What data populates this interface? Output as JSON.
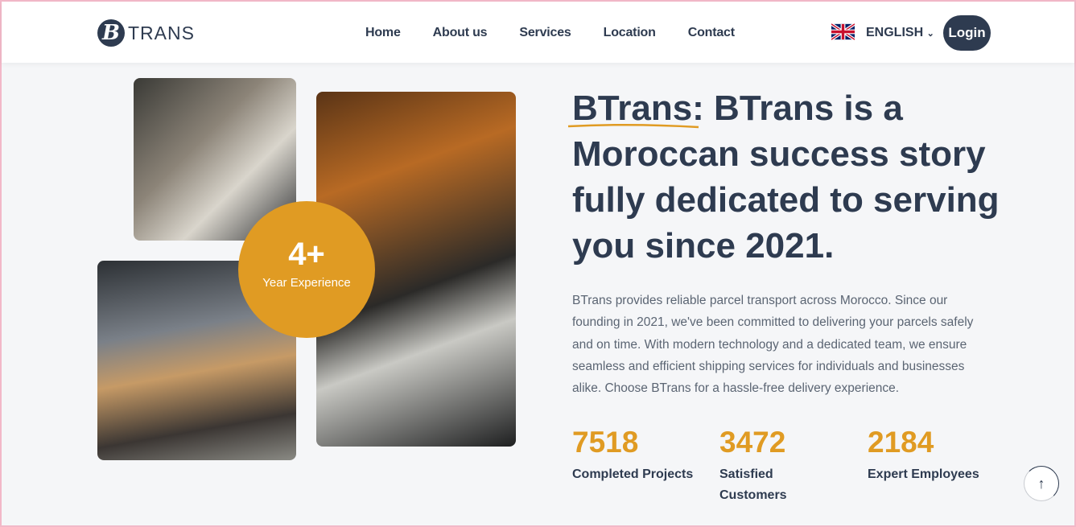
{
  "header": {
    "logo_mark": "B",
    "logo_text": "TRANS",
    "nav": [
      "Home",
      "About us",
      "Services",
      "Location",
      "Contact"
    ],
    "language": "ENGLISH",
    "login": "Login"
  },
  "badge": {
    "number": "4+",
    "label": "Year Experience"
  },
  "hero": {
    "title": "BTrans: BTrans is a Moroccan success story fully dedicated to serving you since 2021.",
    "description": "BTrans provides reliable parcel transport across Morocco. Since our founding in 2021, we've been committed to delivering your parcels safely and on time. With modern technology and a dedicated team, we ensure seamless and efficient shipping services for individuals and businesses alike. Choose BTrans for a hassle-free delivery experience."
  },
  "stats": [
    {
      "value": "7518",
      "label": "Completed Projects"
    },
    {
      "value": "3472",
      "label": "Satisfied Customers"
    },
    {
      "value": "2184",
      "label": "Expert Employees"
    }
  ],
  "colors": {
    "primary": "#2e3b50",
    "accent": "#e09b23"
  }
}
